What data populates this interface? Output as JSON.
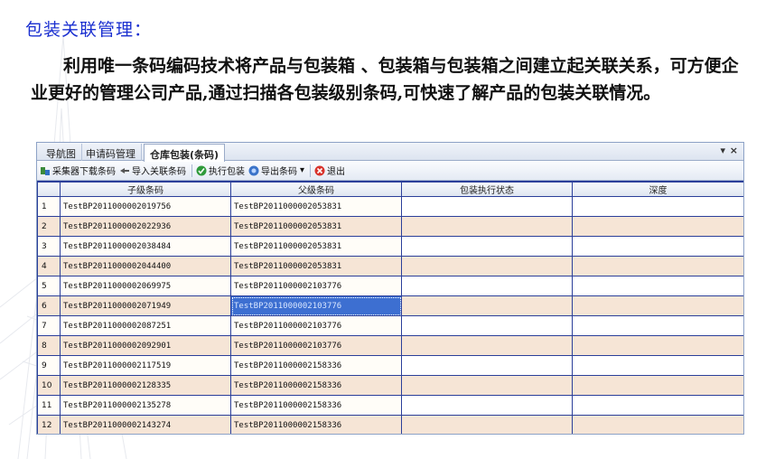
{
  "slide": {
    "title": "包装关联管理：",
    "paragraph": "利用唯一条码编码技术将产品与包装箱 、包装箱与包装箱之间建立起关联关系，可方便企业更好的管理公司产品,通过扫描各包装级别条码,可快速了解产品的包装关联情况。"
  },
  "tabs": [
    "导航图",
    "申请码管理",
    "仓库包装(条码)"
  ],
  "tab_controls": {
    "dropdown": "▾",
    "close": "×"
  },
  "toolbar": {
    "download": "采集器下载条码",
    "import": "导入关联条码",
    "execute": "执行包装",
    "export": "导出条码",
    "export_arrow": "▾",
    "exit": "退出"
  },
  "grid": {
    "columns": [
      "子级条码",
      "父级条码",
      "包装执行状态",
      "深度"
    ],
    "rows": [
      {
        "n": "1",
        "child": "TestBP2011000002019756",
        "parent": "TestBP2011000002053831",
        "status": "",
        "depth": ""
      },
      {
        "n": "2",
        "child": "TestBP2011000002022936",
        "parent": "TestBP2011000002053831",
        "status": "",
        "depth": ""
      },
      {
        "n": "3",
        "child": "TestBP2011000002038484",
        "parent": "TestBP2011000002053831",
        "status": "",
        "depth": ""
      },
      {
        "n": "4",
        "child": "TestBP2011000002044400",
        "parent": "TestBP2011000002053831",
        "status": "",
        "depth": ""
      },
      {
        "n": "5",
        "child": "TestBP2011000002069975",
        "parent": "TestBP2011000002103776",
        "status": "",
        "depth": ""
      },
      {
        "n": "6",
        "child": "TestBP2011000002071949",
        "parent": "TestBP2011000002103776",
        "status": "",
        "depth": ""
      },
      {
        "n": "7",
        "child": "TestBP2011000002087251",
        "parent": "TestBP2011000002103776",
        "status": "",
        "depth": ""
      },
      {
        "n": "8",
        "child": "TestBP2011000002092901",
        "parent": "TestBP2011000002103776",
        "status": "",
        "depth": ""
      },
      {
        "n": "9",
        "child": "TestBP2011000002117519",
        "parent": "TestBP2011000002158336",
        "status": "",
        "depth": ""
      },
      {
        "n": "10",
        "child": "TestBP2011000002128335",
        "parent": "TestBP2011000002158336",
        "status": "",
        "depth": ""
      },
      {
        "n": "11",
        "child": "TestBP2011000002135278",
        "parent": "TestBP2011000002158336",
        "status": "",
        "depth": ""
      },
      {
        "n": "12",
        "child": "TestBP2011000002143274",
        "parent": "TestBP2011000002158336",
        "status": "",
        "depth": ""
      }
    ],
    "selected_row": 6
  },
  "colors": {
    "title": "#1a2fd0",
    "grid_line": "#2b3f9a",
    "row_alt": "#f6e5d6",
    "selection": "#3d6fd1"
  },
  "icons": [
    "download-icon",
    "import-icon",
    "execute-check-icon",
    "export-icon",
    "exit-icon"
  ]
}
